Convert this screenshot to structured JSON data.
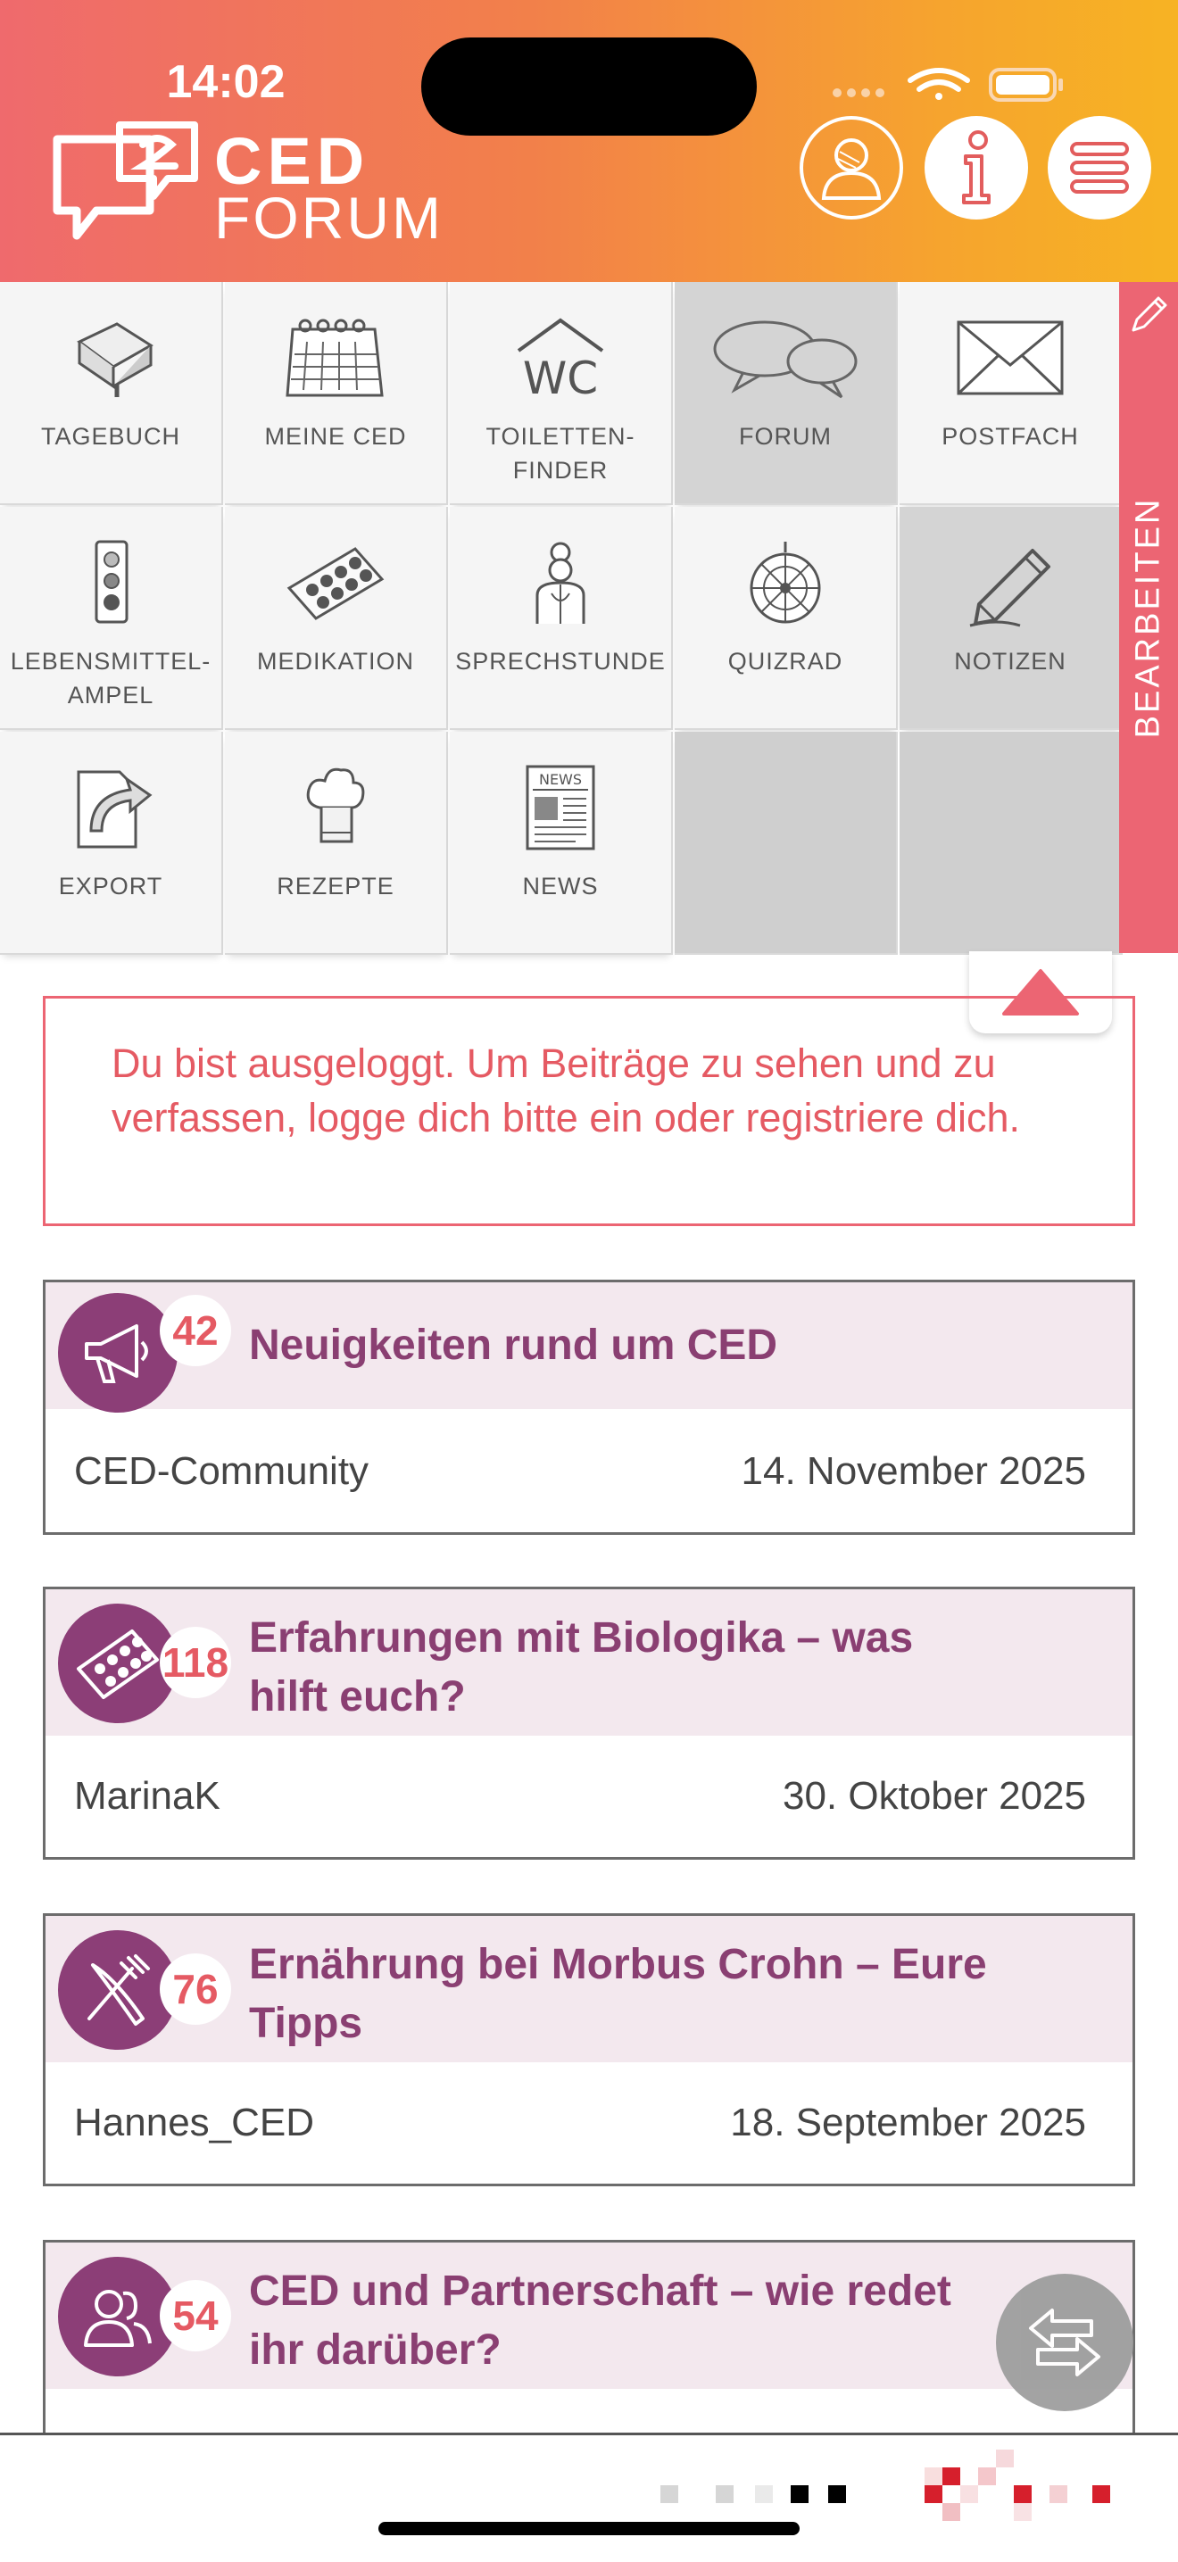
{
  "status_bar": {
    "time": "14:02"
  },
  "header": {
    "logo_line1": "CED",
    "logo_line2": "FORUM",
    "buttons": [
      {
        "name": "profile",
        "icon": "user-icon"
      },
      {
        "name": "info",
        "icon": "info-icon"
      },
      {
        "name": "menu",
        "icon": "hamburger-menu-icon"
      }
    ]
  },
  "tiles": [
    {
      "label": "TAGEBUCH",
      "icon": "diary-book-icon",
      "active": false
    },
    {
      "label": "MEINE CED",
      "icon": "calendar-icon",
      "active": false
    },
    {
      "label": "TOILETTEN-\nFINDER",
      "icon": "wc-icon",
      "active": false
    },
    {
      "label": "FORUM",
      "icon": "speech-bubbles-icon",
      "active": true
    },
    {
      "label": "POSTFACH",
      "icon": "envelope-icon",
      "active": false
    },
    {
      "label": "LEBENSMITTEL-\nAMPEL",
      "icon": "traffic-light-icon",
      "active": false
    },
    {
      "label": "MEDIKATION",
      "icon": "pill-blister-icon",
      "active": false
    },
    {
      "label": "SPRECHSTUNDE",
      "icon": "doctor-icon",
      "active": false
    },
    {
      "label": "QUIZRAD",
      "icon": "quiz-wheel-icon",
      "active": false
    },
    {
      "label": "NOTIZEN",
      "icon": "pencil-notes-icon",
      "active": true
    },
    {
      "label": "EXPORT",
      "icon": "export-document-icon",
      "active": false
    },
    {
      "label": "REZEPTE",
      "icon": "chef-hat-icon",
      "active": false
    },
    {
      "label": "NEWS",
      "icon": "newspaper-icon",
      "active": false
    }
  ],
  "edit_bar": {
    "label": "BEARBEITEN"
  },
  "notice": "Du bist ausgeloggt. Um Beiträge zu sehen und zu verfassen, logge dich bitte ein oder registriere dich.",
  "posts": [
    {
      "count": "42",
      "title": "Neuigkeiten rund um CED",
      "author": "CED-Community",
      "date": "14. November 2025",
      "icon": "megaphone-icon"
    },
    {
      "count": "118",
      "title": "Erfahrungen mit Biologika – was hilft euch?",
      "author": "MarinaK",
      "date": "30. Oktober 2025",
      "icon": "pill-blister-icon"
    },
    {
      "count": "76",
      "title": "Ernährung bei Morbus Crohn – Eure Tipps",
      "author": "Hannes_CED",
      "date": "18. September 2025",
      "icon": "fork-knife-icon"
    },
    {
      "count": "54",
      "title": "CED und Partnerschaft – wie redet ihr darüber?",
      "author": "",
      "date": "",
      "icon": "people-icon"
    }
  ],
  "colors": {
    "accent": "#ec6573",
    "forum_purple": "#8a3f72",
    "header_start": "#ef6a6d",
    "header_end": "#f7b323"
  }
}
